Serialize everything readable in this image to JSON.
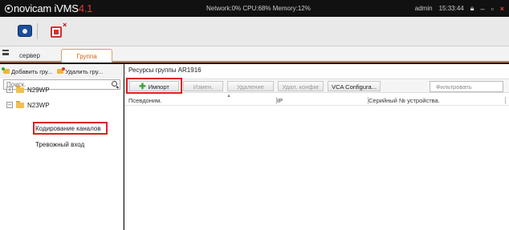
{
  "app": {
    "brand": "novicam",
    "product": "iVMS",
    "version": "4.1"
  },
  "titlebar": {
    "network": "Network:0%",
    "cpu": "CPU:68%",
    "memory": "Memory:12%",
    "user": "admin",
    "time": "15:33:44",
    "lock_icon": "lock-icon",
    "minimize": "–",
    "maximize": "▫",
    "close": "×"
  },
  "toolbar": {
    "buttons": [
      "main-view-icon",
      "device-management-icon"
    ]
  },
  "tabs": [
    {
      "label": "сервер",
      "active": false
    },
    {
      "label": "Группа",
      "active": true
    }
  ],
  "left": {
    "add_group": "Добавить гру...",
    "delete_group": "Удалить гру...",
    "search_placeholder": "Поиск.",
    "tree": [
      {
        "label": "N29WP",
        "expanded": false,
        "expander": "+"
      },
      {
        "label": "N23WP",
        "expanded": true,
        "expander": "−",
        "children": [
          "Кодирование каналов",
          "Тревожный вход"
        ]
      }
    ]
  },
  "right": {
    "title": "Ресурсы группы AR1916",
    "buttons": {
      "import": "Импорт",
      "edit": "Измен.",
      "delete": "Удаление",
      "delete_config": "Удал. конфиг",
      "vca": "VCA Configura..."
    },
    "filter_placeholder": "Фильтровать",
    "columns": [
      "Псевдоним.",
      "IP",
      "Серийный № устройства."
    ],
    "rows": []
  },
  "colors": {
    "accent": "#e07a2e",
    "highlight": "#e02020",
    "version": "#e23a2e"
  }
}
